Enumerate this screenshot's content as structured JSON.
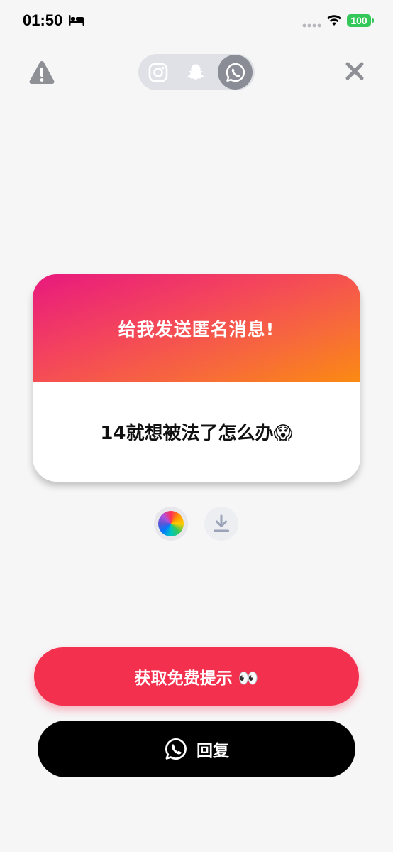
{
  "status_bar": {
    "time": "01:50",
    "battery": "100",
    "icons": [
      "bed-icon",
      "signal-dots-icon",
      "wifi-icon",
      "battery-icon"
    ]
  },
  "top_bar": {
    "warning_icon": "warning-icon",
    "close_icon": "close-icon",
    "platforms": [
      "instagram-icon",
      "snapchat-icon",
      "whatsapp-icon"
    ],
    "selected_platform": "whatsapp"
  },
  "card": {
    "header": "给我发送匿名消息!",
    "message": "14就想被法了怎么办😱"
  },
  "tools": {
    "color_icon": "color-wheel-icon",
    "download_icon": "download-icon"
  },
  "buttons": {
    "hint_label": "获取免费提示 👀",
    "reply_label": "回复",
    "reply_icon": "whatsapp-icon"
  },
  "colors": {
    "background": "#f6f6f7",
    "hint_button": "#f3314e",
    "reply_button": "#000000",
    "gradient_start": "#e8197e",
    "gradient_end": "#fb8a12",
    "battery": "#34c759"
  }
}
